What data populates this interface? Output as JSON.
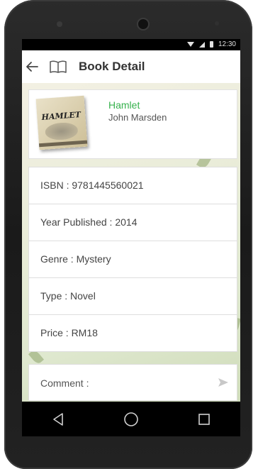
{
  "status_bar": {
    "time": "12:30"
  },
  "app_bar": {
    "title": "Book Detail",
    "back_icon": "arrow-left-icon",
    "book_icon": "open-book-icon"
  },
  "book": {
    "title": "Hamlet",
    "author": "John Marsden",
    "cover_title": "HAMLET"
  },
  "details": [
    {
      "label": "ISBN : 9781445560021"
    },
    {
      "label": "Year Published : 2014"
    },
    {
      "label": "Genre : Mystery"
    },
    {
      "label": "Type : Novel"
    },
    {
      "label": "Price : RM18"
    }
  ],
  "comment": {
    "placeholder": "Comment :",
    "value": "",
    "send_icon": "send-icon"
  },
  "nav_bar": {
    "back": "triangle-back-icon",
    "home": "circle-home-icon",
    "recents": "square-recents-icon"
  },
  "colors": {
    "accent_title": "#37b24d",
    "app_bar_bg": "#ffffff",
    "phone_body": "#222222"
  }
}
